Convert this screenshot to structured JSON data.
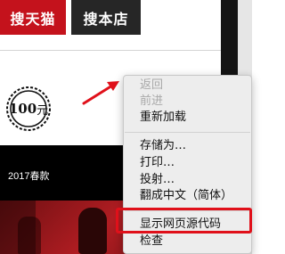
{
  "tabs": {
    "tmall_label": "搜天猫",
    "store_label": "搜本店"
  },
  "coupon": {
    "amount": "100",
    "unit": "元"
  },
  "promo": {
    "text": "2017春款"
  },
  "context_menu": {
    "items": [
      {
        "label": "返回",
        "enabled": false
      },
      {
        "label": "前进",
        "enabled": false
      },
      {
        "label": "重新加载",
        "enabled": true
      },
      {
        "label": "存储为…",
        "enabled": true
      },
      {
        "label": "打印…",
        "enabled": true
      },
      {
        "label": "投射…",
        "enabled": true
      },
      {
        "label": "翻成中文（简体）",
        "enabled": true
      },
      {
        "label": "显示网页源代码",
        "enabled": true,
        "highlighted": true
      },
      {
        "label": "检查",
        "enabled": true
      }
    ]
  },
  "colors": {
    "brand_red": "#c4121c",
    "highlight_red": "#e0101a",
    "dark_tab": "#262626"
  }
}
